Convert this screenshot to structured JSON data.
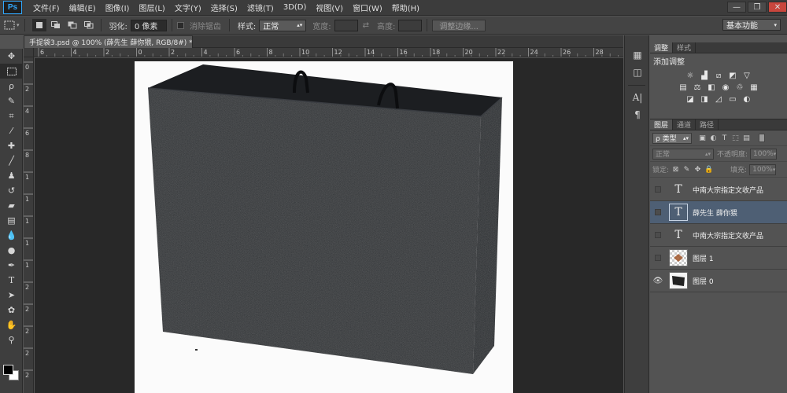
{
  "app": {
    "logo": "Ps"
  },
  "menu": [
    "文件(F)",
    "编辑(E)",
    "图像(I)",
    "图层(L)",
    "文字(Y)",
    "选择(S)",
    "滤镜(T)",
    "3D(D)",
    "视图(V)",
    "窗口(W)",
    "帮助(H)"
  ],
  "window_controls": {
    "minimize": "—",
    "maximize": "❐",
    "close": "✕"
  },
  "options": {
    "feather_label": "羽化:",
    "feather_value": "0 像素",
    "antialias_label": "消除锯齿",
    "style_label": "样式:",
    "style_value": "正常",
    "width_label": "宽度:",
    "height_label": "高度:",
    "refine_edge_label": "调整边缘...",
    "workspace": "基本功能"
  },
  "document": {
    "tab_title": "手提袋3.psd @ 100% (薛先生  薛你猥, RGB/8#) *",
    "close": "×"
  },
  "ruler": {
    "h_ticks": [
      "6",
      "4",
      "2",
      "0",
      "2",
      "4",
      "6",
      "8",
      "10",
      "12",
      "14",
      "16",
      "18",
      "20",
      "22",
      "24",
      "26",
      "28"
    ],
    "v_ticks": [
      "0",
      "2",
      "4",
      "6",
      "8",
      "1",
      "1",
      "1",
      "1",
      "1",
      "2",
      "2",
      "2",
      "2",
      "2"
    ]
  },
  "adjustments": {
    "tabs": [
      "调整",
      "样式"
    ],
    "title": "添加调整"
  },
  "layers_panel": {
    "tabs": [
      "图层",
      "通道",
      "路径"
    ],
    "filter_kind": "ρ 类型",
    "blend_mode": "正常",
    "opacity_label": "不透明度:",
    "opacity_value": "100%",
    "lock_label": "锁定:",
    "fill_label": "填充:",
    "fill_value": "100%",
    "layers": [
      {
        "name": "中南大宗指定文收产品",
        "type": "text",
        "visible": false,
        "selected": false
      },
      {
        "name": "薛先生  薛你猥",
        "type": "text",
        "visible": false,
        "selected": true
      },
      {
        "name": "中南大宗指定文收产品",
        "type": "text",
        "visible": false,
        "selected": false
      },
      {
        "name": "图层 1",
        "type": "image-transparent",
        "visible": false,
        "selected": false
      },
      {
        "name": "图层 0",
        "type": "image-bag",
        "visible": true,
        "selected": false
      }
    ]
  },
  "colors": {
    "foreground": "#000000",
    "background": "#ffffff",
    "selected_layer": "#4e5f74",
    "bag_fill": "#26292d"
  }
}
